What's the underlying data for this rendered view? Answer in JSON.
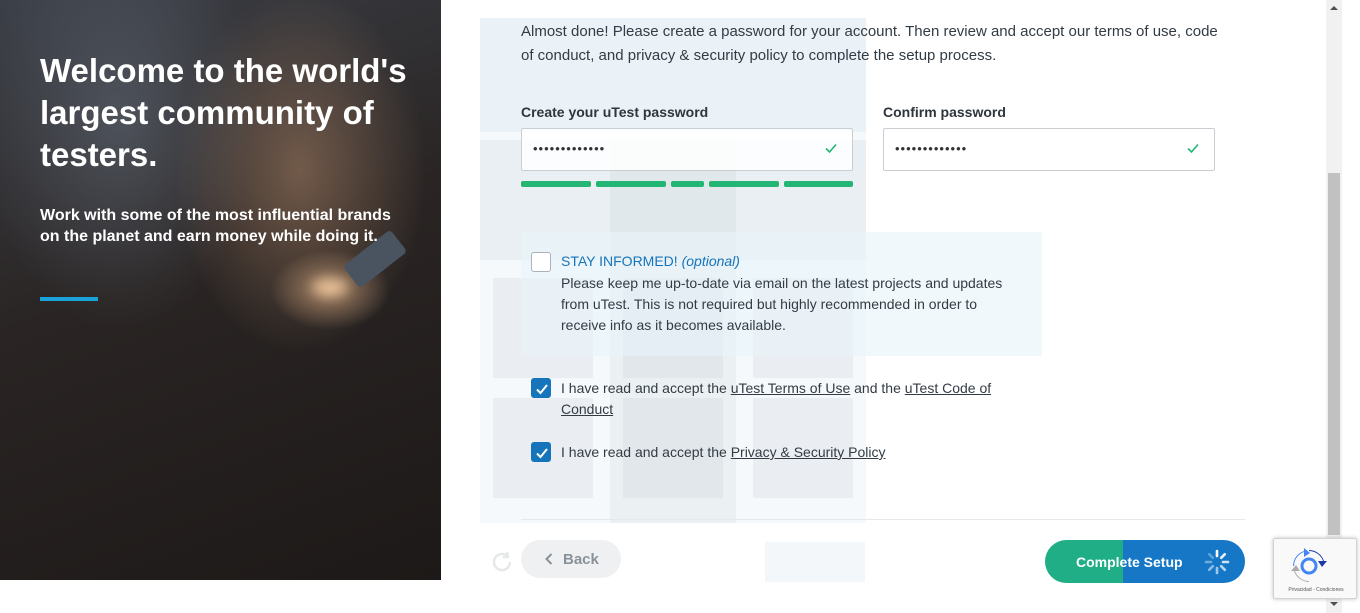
{
  "hero": {
    "title": "Welcome to the world's largest community of testers.",
    "subtitle": "Work with some of the most influential brands on the planet and earn money while doing it."
  },
  "form": {
    "intro": "Almost done! Please create a password for your account. Then review and accept our terms of use, code of conduct, and privacy & security policy to complete the setup process.",
    "password_label": "Create your uTest password",
    "password_value": "•••••••••••••",
    "confirm_label": "Confirm password",
    "confirm_value": "•••••••••••••",
    "strength_level": 1.0,
    "stay_informed": {
      "title": "STAY INFORMED!",
      "optional": "(optional)",
      "text": "Please keep me up-to-date via email on the latest projects and updates from uTest. This is not required but highly recommended in order to receive info as it becomes available.",
      "checked": false
    },
    "terms": {
      "prefix": "I have read and accept the",
      "terms_link": "uTest Terms of Use",
      "and": "and the",
      "code_link": "uTest Code of Conduct",
      "checked": true
    },
    "privacy": {
      "prefix": "I have read and accept the",
      "link": "Privacy & Security Policy",
      "checked": true
    }
  },
  "buttons": {
    "back": "Back",
    "complete": "Complete Setup"
  },
  "recaptcha": {
    "footer": "Privacidad - Condiciones"
  },
  "colors": {
    "accent": "#19a3d8",
    "link_blue": "#1574ba",
    "success_green": "#22b573",
    "button_green": "#1fae86",
    "button_blue": "#1577c6"
  },
  "icons": [
    "check-icon",
    "chevron-left-icon",
    "spinner-icon",
    "recaptcha-icon",
    "arrow-up-icon",
    "arrow-down-icon"
  ]
}
